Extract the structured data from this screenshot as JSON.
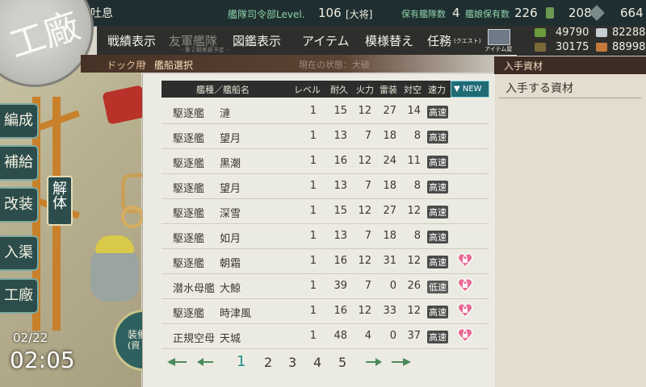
{
  "header": {
    "port_name": "吐息",
    "hq_label": "艦隊司令部Level.",
    "hq_level": "106",
    "rank": "[大将]",
    "fleet_count_label": "保有艦隊数",
    "fleet_count": "4",
    "ship_count_label": "艦娘保有数",
    "ship_count": "226",
    "bucket_count": "208",
    "devmat_count": "664"
  },
  "resources": {
    "fuel": "49790",
    "steel": "82288",
    "ammo": "30175",
    "bauxite": "88998",
    "item_shop_label": "アイテム屋"
  },
  "menu": {
    "items": [
      "戦績表示",
      "友軍艦隊",
      "図鑑表示",
      "アイテム",
      "模様替え",
      "任務"
    ],
    "friend_fleet_sub": "- 第２期実装予定 -",
    "quest_sub": "(クエスト)"
  },
  "breadcrumb": {
    "first": "ドック用",
    "second": "艦船選択",
    "ghost": "現在の状態：大破"
  },
  "right_panel": {
    "title": "入手資材",
    "subtitle": "入手する資材"
  },
  "side_nav": {
    "items": [
      "編成",
      "補給",
      "改装",
      "入渠",
      "工廠"
    ],
    "dismantle": "解体"
  },
  "emblem": {
    "text": "工廠"
  },
  "build_button": {
    "line1": "装備",
    "line2": "(資"
  },
  "datetime": {
    "date": "02/22",
    "time": "02:05"
  },
  "table": {
    "columns": [
      "艦種／艦船名",
      "レベル",
      "耐久",
      "火力",
      "雷装",
      "対空",
      "速力"
    ],
    "sort_label": "NEW",
    "rows": [
      {
        "type": "駆逐艦",
        "name": "漣",
        "level": "1",
        "hp": "15",
        "fire": "12",
        "torp": "27",
        "aa": "14",
        "speed": "高速",
        "locked": false
      },
      {
        "type": "駆逐艦",
        "name": "望月",
        "level": "1",
        "hp": "13",
        "fire": "7",
        "torp": "18",
        "aa": "8",
        "speed": "高速",
        "locked": false
      },
      {
        "type": "駆逐艦",
        "name": "黒潮",
        "level": "1",
        "hp": "16",
        "fire": "12",
        "torp": "24",
        "aa": "11",
        "speed": "高速",
        "locked": false
      },
      {
        "type": "駆逐艦",
        "name": "望月",
        "level": "1",
        "hp": "13",
        "fire": "7",
        "torp": "18",
        "aa": "8",
        "speed": "高速",
        "locked": false
      },
      {
        "type": "駆逐艦",
        "name": "深雪",
        "level": "1",
        "hp": "15",
        "fire": "12",
        "torp": "27",
        "aa": "12",
        "speed": "高速",
        "locked": false
      },
      {
        "type": "駆逐艦",
        "name": "如月",
        "level": "1",
        "hp": "13",
        "fire": "7",
        "torp": "18",
        "aa": "8",
        "speed": "高速",
        "locked": false
      },
      {
        "type": "駆逐艦",
        "name": "朝霜",
        "level": "1",
        "hp": "16",
        "fire": "12",
        "torp": "31",
        "aa": "12",
        "speed": "高速",
        "locked": true
      },
      {
        "type": "潜水母艦",
        "name": "大鯨",
        "level": "1",
        "hp": "39",
        "fire": "7",
        "torp": "0",
        "aa": "26",
        "speed": "低速",
        "locked": true
      },
      {
        "type": "駆逐艦",
        "name": "時津風",
        "level": "1",
        "hp": "16",
        "fire": "12",
        "torp": "33",
        "aa": "12",
        "speed": "高速",
        "locked": true
      },
      {
        "type": "正規空母",
        "name": "天城",
        "level": "1",
        "hp": "48",
        "fire": "4",
        "torp": "0",
        "aa": "37",
        "speed": "高速",
        "locked": true
      }
    ]
  },
  "pagination": {
    "pages": [
      "1",
      "2",
      "3",
      "4",
      "5"
    ],
    "current": "1"
  },
  "colors": {
    "topbar": "#1f2f31",
    "accent_teal": "#1f6b76",
    "lock_pink": "#e76a93",
    "breadcrumb": "#5c4334"
  }
}
